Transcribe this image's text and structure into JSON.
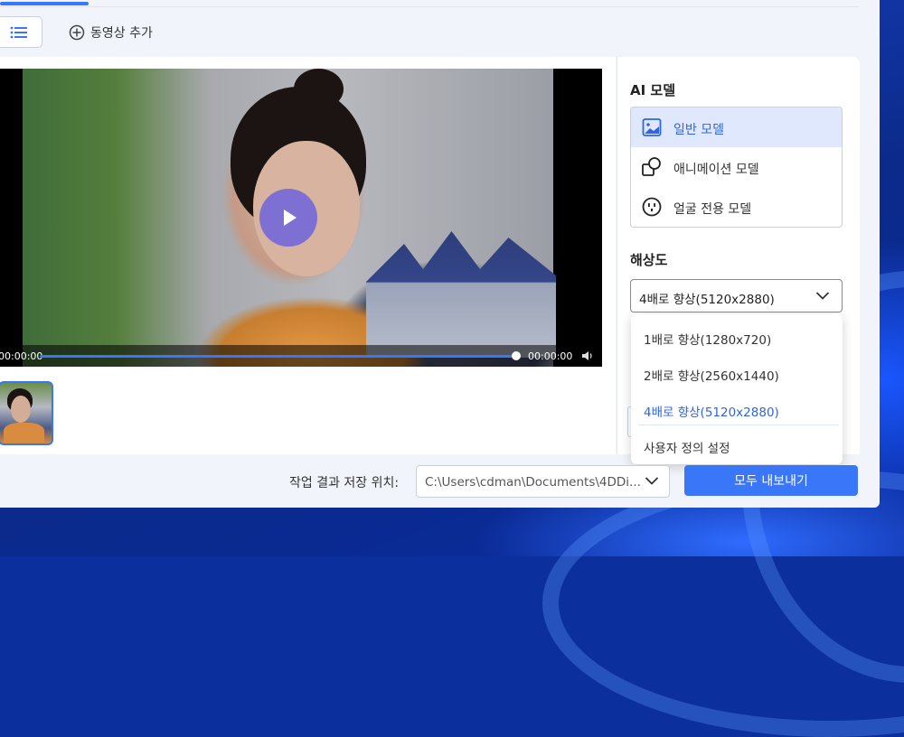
{
  "toolbar": {
    "add_video_label": "동영상 추가"
  },
  "player": {
    "current_time": "00:00:00",
    "end_time": "00:00:00",
    "progress": 1.0
  },
  "ai_model": {
    "title": "AI 모델",
    "items": [
      {
        "label": "일반 모델",
        "icon": "image-icon",
        "selected": true
      },
      {
        "label": "애니메이션 모델",
        "icon": "shapes-icon",
        "selected": false
      },
      {
        "label": "얼굴 전용 모델",
        "icon": "face-icon",
        "selected": false
      }
    ]
  },
  "resolution": {
    "title": "해상도",
    "selected": "4배로 향상(5120x2880)",
    "options": [
      "1배로 향상(1280x720)",
      "2배로 향상(2560x1440)",
      "4배로 향상(5120x2880)",
      "사용자 정의 설정"
    ]
  },
  "footer": {
    "save_location_label": "작업 결과 저장 위치:",
    "save_path": "C:\\Users\\cdman\\Documents\\4DDi...",
    "export_button": "모두 내보내기"
  },
  "colors": {
    "accent": "#3a76f8",
    "selected_bg": "#dfe8fd"
  }
}
